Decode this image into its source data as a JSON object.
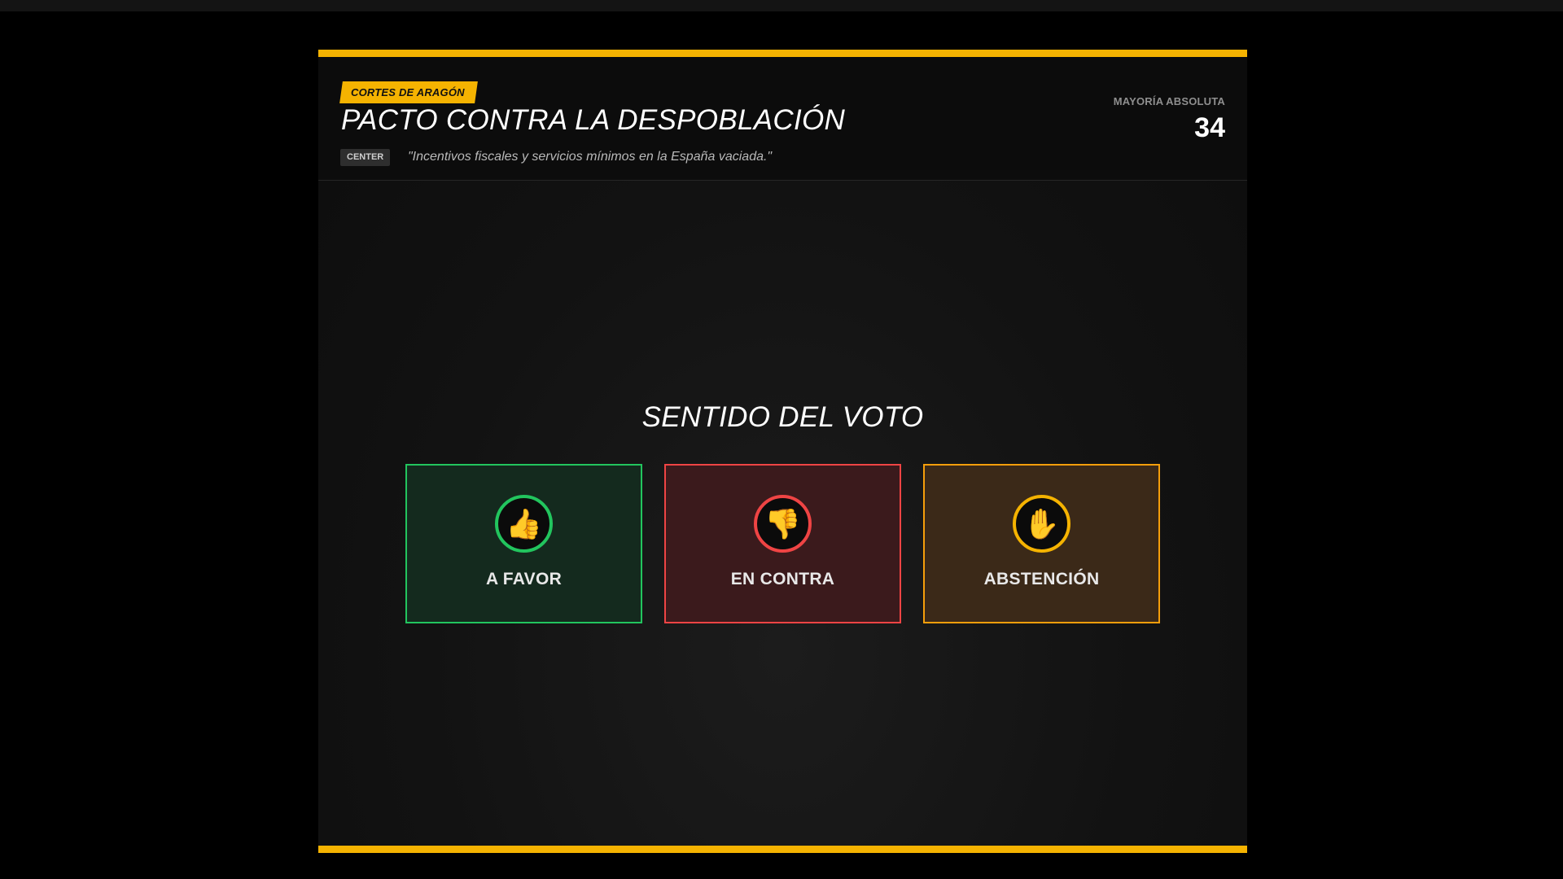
{
  "header": {
    "chamber": "CORTES DE ARAGÓN",
    "title": "PACTO CONTRA LA DESPOBLACIÓN",
    "ideology": "CENTER",
    "quote": "\"Incentivos fiscales y servicios mínimos en la España vaciada.\"",
    "majority_label": "MAYORÍA ABSOLUTA",
    "majority_value": "34"
  },
  "vote": {
    "prompt": "SENTIDO DEL VOTO",
    "options": [
      {
        "label": "A FAVOR",
        "icon": "thumbs-up-icon",
        "color": "#22c55e"
      },
      {
        "label": "EN CONTRA",
        "icon": "thumbs-down-icon",
        "color": "#ef4444"
      },
      {
        "label": "ABSTENCIÓN",
        "icon": "raised-hand-icon",
        "color": "#f59e0b"
      }
    ]
  },
  "colors": {
    "accent": "#f5b301",
    "background": "#000000"
  }
}
